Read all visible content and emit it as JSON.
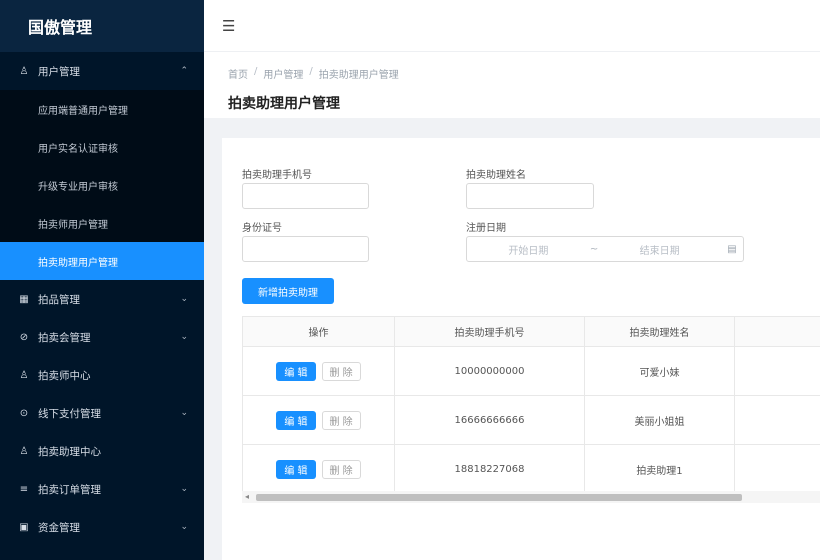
{
  "app": {
    "title": "国傲管理"
  },
  "sidebar": {
    "groups": [
      {
        "label": "用户管理",
        "icon": "users-icon",
        "arrow": "⌃",
        "expanded": true,
        "items": [
          {
            "label": "应用端普通用户管理"
          },
          {
            "label": "用户实名认证审核"
          },
          {
            "label": "升级专业用户审核"
          },
          {
            "label": "拍卖师用户管理"
          },
          {
            "label": "拍卖助理用户管理",
            "active": true
          }
        ]
      },
      {
        "label": "拍品管理",
        "icon": "grid-icon",
        "arrow": "⌄"
      },
      {
        "label": "拍卖会管理",
        "icon": "compass-icon",
        "arrow": "⌄"
      },
      {
        "label": "拍卖师中心",
        "icon": "user-icon",
        "arrow": ""
      },
      {
        "label": "线下支付管理",
        "icon": "clock-icon",
        "arrow": "⌄"
      },
      {
        "label": "拍卖助理中心",
        "icon": "user-icon",
        "arrow": ""
      },
      {
        "label": "拍卖订单管理",
        "icon": "list-icon",
        "arrow": "⌄"
      },
      {
        "label": "资金管理",
        "icon": "wallet-icon",
        "arrow": "⌄"
      }
    ]
  },
  "header": {
    "fold_icon": "menu-fold-icon"
  },
  "breadcrumb": [
    "首页",
    "用户管理",
    "拍卖助理用户管理"
  ],
  "page_title": "拍卖助理用户管理",
  "filters": {
    "phone_label": "拍卖助理手机号",
    "name_label": "拍卖助理姓名",
    "id_label": "身份证号",
    "date_label": "注册日期",
    "date_start_placeholder": "开始日期",
    "date_end_placeholder": "结束日期",
    "date_separator": "~"
  },
  "actions": {
    "add_label": "新增拍卖助理"
  },
  "table": {
    "columns": [
      "操作",
      "拍卖助理手机号",
      "拍卖助理姓名",
      ""
    ],
    "edit_label": "编 辑",
    "delete_label": "删 除",
    "rows": [
      {
        "phone": "10000000000",
        "name": "可爱小妹"
      },
      {
        "phone": "16666666666",
        "name": "美丽小姐姐"
      },
      {
        "phone": "18818227068",
        "name": "拍卖助理1"
      }
    ]
  }
}
